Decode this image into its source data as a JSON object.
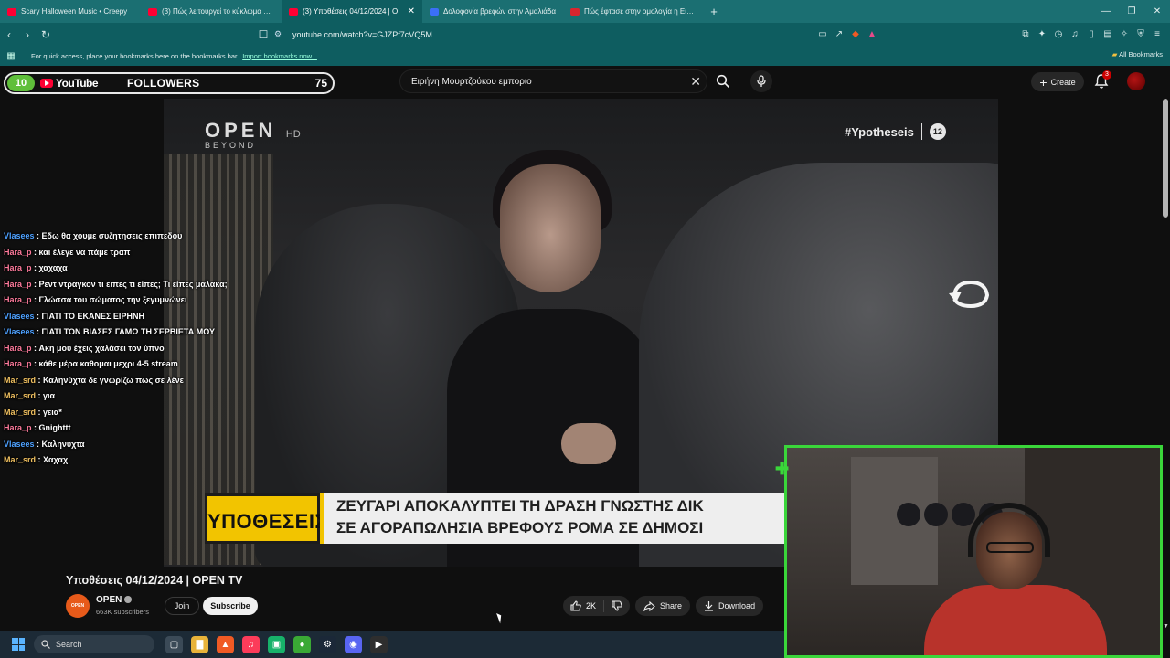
{
  "browser": {
    "tabs": [
      {
        "label": "Scary Halloween Music • Creepy",
        "favicon_color": "#ff0033",
        "active": false
      },
      {
        "label": "(3) Πώς λειτουργεί το κύκλωμα παρ",
        "favicon_color": "#ff0033",
        "active": false
      },
      {
        "label": "(3) Υποθέσεις 04/12/2024 | O",
        "favicon_color": "#ff0033",
        "active": true
      },
      {
        "label": "Δολοφονία βρεφών στην Αμαλιάδα",
        "favicon_color": "#3b6ff5",
        "active": false
      },
      {
        "label": "Πώς έφτασε στην ομολογία η Ειρήν",
        "favicon_color": "#d8262f",
        "active": false
      }
    ],
    "new_tab": "+",
    "url": "youtube.com/watch?v=GJZPf7cVQ5M",
    "bookmarks_message": "For quick access, place your bookmarks here on the bookmarks bar.",
    "import_link": "Import bookmarks now...",
    "all_bookmarks": "All Bookmarks"
  },
  "overlay": {
    "left_count": "10",
    "yt_word": "YouTube",
    "followers_label": "FOLLOWERS",
    "right_count": "75"
  },
  "youtube": {
    "search_value": "Ειρήνη Μουρτζούκου εμποριο",
    "create_label": "Create",
    "notification_count": "3"
  },
  "video": {
    "channel_logo": "OPEN",
    "channel_logo_hd": "HD",
    "channel_logo_sub": "BEYOND",
    "hashtag": "#Ypotheseis",
    "rating": "12",
    "lower_third_tag": "ΥΠΟΘΕΣΕΙΣ",
    "headline_line1": "ΖΕΥΓΑΡΙ ΑΠΟΚΑΛΥΠΤΕΙ ΤΗ ΔΡΑΣΗ ΓΝΩΣΤΗΣ ΔΙΚ",
    "headline_line2": "ΣΕ ΑΓΟΡΑΠΩΛΗΣΙΑ ΒΡΕΦΟΥΣ ΡΟΜΑ ΣΕ ΔΗΜΟΣΙ"
  },
  "chat": [
    {
      "user": "Vlasees",
      "color": "#4ea1ff",
      "text": "Εδω θα χουμε συζητησεις επιπεδου"
    },
    {
      "user": "Hara_p",
      "color": "#ff7a9c",
      "text": "και έλεγε να πάμε τραπ"
    },
    {
      "user": "Hara_p",
      "color": "#ff7a9c",
      "text": "χαχαχα"
    },
    {
      "user": "Hara_p",
      "color": "#ff7a9c",
      "text": "Ρεντ ντραγκον τι ειπες τι είπες; Τι είπες μαλακα;"
    },
    {
      "user": "Hara_p",
      "color": "#ff7a9c",
      "text": "Γλώσσα του σώματος την ξεγυμνώνει"
    },
    {
      "user": "Vlasees",
      "color": "#4ea1ff",
      "text": "ΓΙΑΤΙ ΤΟ ΕΚΑΝΕΣ ΕΙΡΗΝΗ"
    },
    {
      "user": "Vlasees",
      "color": "#4ea1ff",
      "text": "ΓΙΑΤΙ ΤΟΝ ΒΙΑΣΕΣ ΓΑΜΩ ΤΗ ΣΕΡΒΙΕΤΑ ΜΟΥ"
    },
    {
      "user": "Hara_p",
      "color": "#ff7a9c",
      "text": "Ακη μου έχεις χαλάσει τον ύπνο"
    },
    {
      "user": "Hara_p",
      "color": "#ff7a9c",
      "text": "κάθε μέρα καθομαι μεχρι 4-5 stream"
    },
    {
      "user": "Mar_srd",
      "color": "#f0c060",
      "text": "Καληνύχτα δε γνωρίζω πως σε λένε"
    },
    {
      "user": "Mar_srd",
      "color": "#f0c060",
      "text": "για"
    },
    {
      "user": "Mar_srd",
      "color": "#f0c060",
      "text": "γεια*"
    },
    {
      "user": "Hara_p",
      "color": "#ff7a9c",
      "text": "Gnighttt"
    },
    {
      "user": "Vlasees",
      "color": "#4ea1ff",
      "text": "Καληνυχτα"
    },
    {
      "user": "Mar_srd",
      "color": "#f0c060",
      "text": "Χαχαχ"
    }
  ],
  "info": {
    "title": "Υποθέσεις 04/12/2024 | OPEN TV",
    "channel_name": "OPEN",
    "channel_avatar_text": "OPEN",
    "subscribers": "663K subscribers",
    "join_label": "Join",
    "subscribe_label": "Subscribe",
    "likes": "2K",
    "share_label": "Share",
    "download_label": "Download"
  },
  "taskbar": {
    "search_label": "Search",
    "icons": [
      {
        "name": "task-view-icon",
        "color": "#3b4a57",
        "glyph": "▢"
      },
      {
        "name": "file-explorer-icon",
        "color": "#e8b33a",
        "glyph": "▇"
      },
      {
        "name": "brave-browser-icon",
        "color": "#f05a24",
        "glyph": "▲"
      },
      {
        "name": "music-app-icon",
        "color": "#fc3c5a",
        "glyph": "♫"
      },
      {
        "name": "xbox-app-icon",
        "color": "#17b26a",
        "glyph": "▣"
      },
      {
        "name": "green-app-icon",
        "color": "#3aa935",
        "glyph": "●"
      },
      {
        "name": "steam-icon",
        "color": "#1b2838",
        "glyph": "⚙"
      },
      {
        "name": "discord-icon",
        "color": "#5865f2",
        "glyph": "◉"
      },
      {
        "name": "media-player-icon",
        "color": "#2e2e2e",
        "glyph": "▶"
      }
    ]
  }
}
